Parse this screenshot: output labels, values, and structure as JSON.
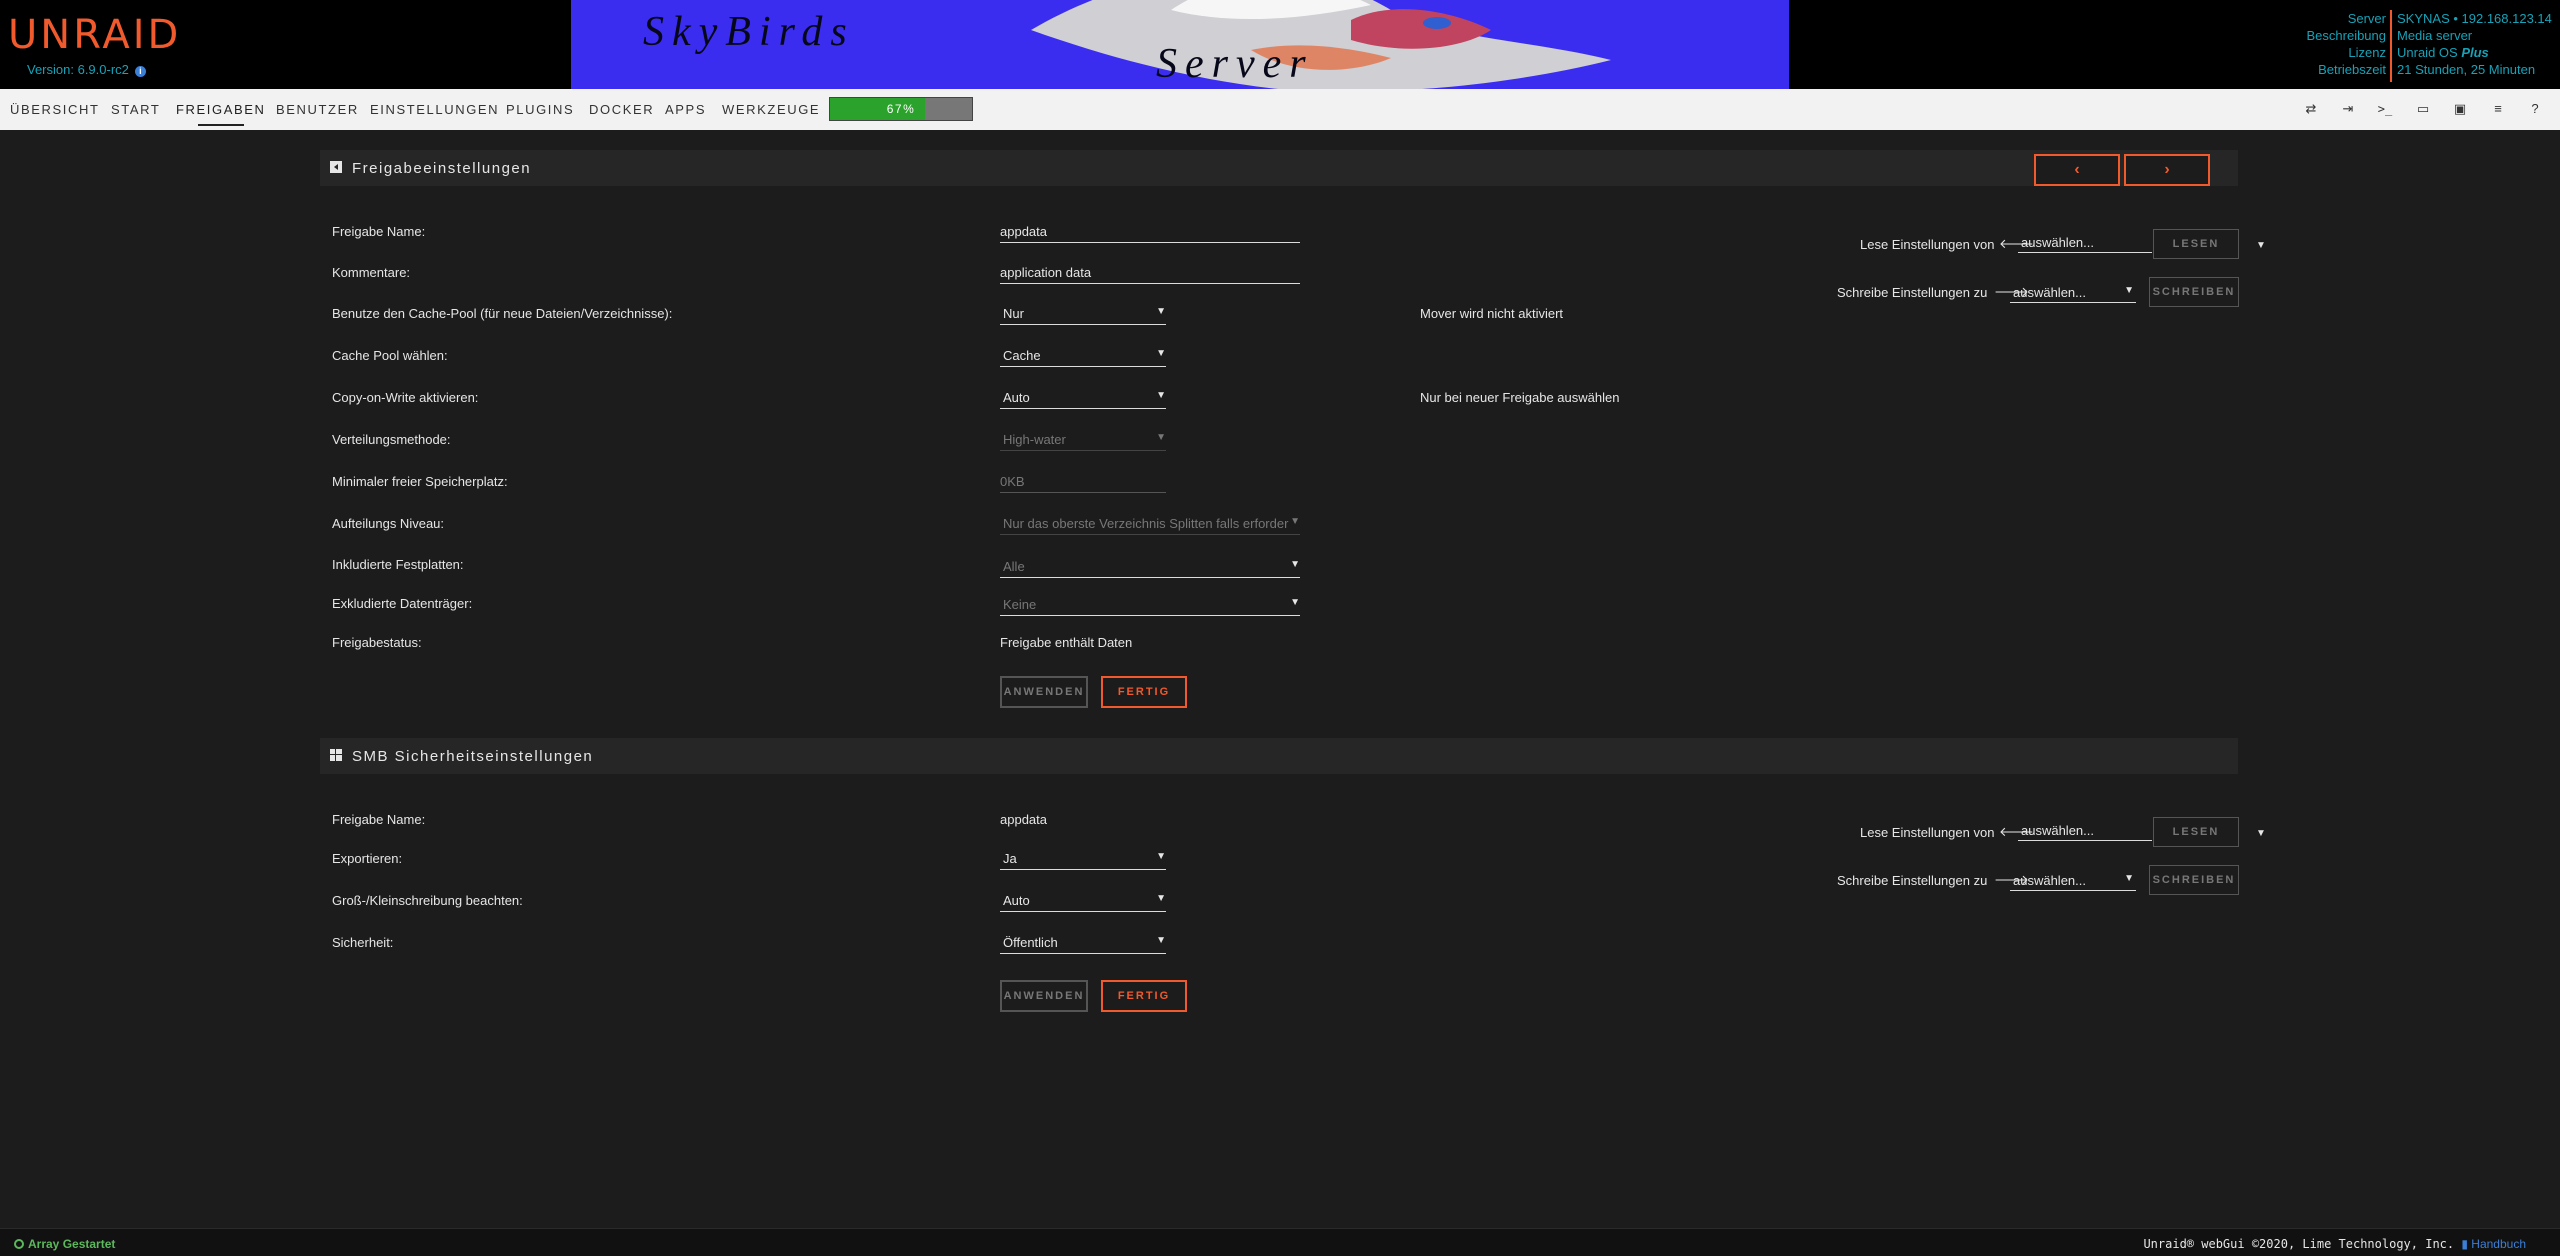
{
  "header": {
    "logo": "UNRAID",
    "version": "Version: 6.9.0-rc2",
    "banner_text_1": "SkyBirds",
    "banner_text_2": "Server",
    "server_labels": [
      "Server",
      "Beschreibung",
      "Lizenz",
      "Betriebszeit"
    ],
    "server_name": "SKYNAS • 192.168.123.14",
    "description": "Media server",
    "license_prefix": "Unraid OS ",
    "license_plan": "Plus",
    "uptime": "21 Stunden, 25 Minuten"
  },
  "nav": {
    "items": [
      "ÜBERSICHT",
      "START",
      "FREIGABEN",
      "BENUTZER",
      "EINSTELLUNGEN",
      "PLUGINS",
      "DOCKER",
      "APPS",
      "WERKZEUGE"
    ],
    "active": "FREIGABEN",
    "progress_label": "67%",
    "progress_fraction": 0.67,
    "icons": [
      "switch-language-icon",
      "logout-icon",
      "terminal-icon",
      "feedback-icon",
      "info-icon",
      "log-icon",
      "help-icon"
    ]
  },
  "share_settings": {
    "title": "Freigabeeinstellungen",
    "prev_button": "‹",
    "next_button": "›",
    "share_name_label": "Freigabe Name:",
    "share_name_value": "appdata",
    "comments_label": "Kommentare:",
    "comments_value": "application data",
    "use_cache_label": "Benutze den Cache-Pool (für neue Dateien/Verzeichnisse):",
    "use_cache_value": "Nur",
    "use_cache_note": "Mover wird nicht aktiviert",
    "cache_pool_label": "Cache Pool wählen:",
    "cache_pool_value": "Cache",
    "cow_label": "Copy-on-Write aktivieren:",
    "cow_value": "Auto",
    "cow_note": "Nur bei neuer Freigabe auswählen",
    "allocation_label": "Verteilungsmethode:",
    "allocation_value": "High-water",
    "min_free_label": "Minimaler freier Speicherplatz:",
    "min_free_value": "0KB",
    "split_label": "Aufteilungs Niveau:",
    "split_value": "Nur das oberste Verzeichnis Splitten falls erforder",
    "included_label": "Inkludierte Festplatten:",
    "included_value": "Alle",
    "excluded_label": "Exkludierte Datenträger:",
    "excluded_value": "Keine",
    "status_label": "Freigabestatus:",
    "status_value": "Freigabe enthält Daten",
    "apply_button": "ANWENDEN",
    "done_button": "FERTIG",
    "read_settings_label": "Lese Einstellungen von",
    "read_settings_value": "auswählen...",
    "read_button": "LESEN",
    "write_settings_label": "Schreibe Einstellungen zu",
    "write_settings_value": "auswählen...",
    "write_button": "SCHREIBEN"
  },
  "smb_settings": {
    "title": "SMB Sicherheitseinstellungen",
    "share_name_label": "Freigabe Name:",
    "share_name_value": "appdata",
    "export_label": "Exportieren:",
    "export_value": "Ja",
    "case_label": "Groß-/Kleinschreibung beachten:",
    "case_value": "Auto",
    "security_label": "Sicherheit:",
    "security_value": "Öffentlich",
    "apply_button": "ANWENDEN",
    "done_button": "FERTIG",
    "read_settings_label": "Lese Einstellungen von",
    "read_settings_value": "auswählen...",
    "read_button": "LESEN",
    "write_settings_label": "Schreibe Einstellungen zu",
    "write_settings_value": "auswählen...",
    "write_button": "SCHREIBEN"
  },
  "footer": {
    "array_status": "Array Gestartet",
    "copyright": "Unraid® webGui ©2020, Lime Technology, Inc. ",
    "manual": "Handbuch"
  }
}
